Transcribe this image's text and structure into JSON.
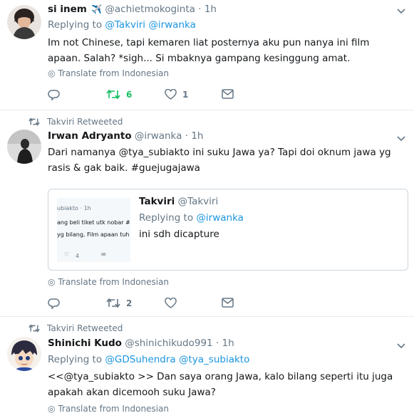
{
  "tweets": [
    {
      "name": "si inem",
      "handle": "@achietmokoginta",
      "time": "1h",
      "replying_label": "Replying to",
      "replying_handles": "@Takviri @irwanka",
      "text": "Im not Chinese, tapi kemaren liat posternya aku pun nanya ini film apaan. Salah? *sigh... Si mbaknya gampang kesinggung amat.",
      "translate": "Translate from Indonesian",
      "retweets": "6",
      "likes": "1"
    },
    {
      "context": "Takviri Retweeted",
      "name": "Irwan Adryanto",
      "handle": "@irwanka",
      "time": "1h",
      "text": "Dari namanya @tya_subiakto ini suku Jawa ya? Tapi doi oknum jawa yg rasis & gak baik. #guejugajawa",
      "quote": {
        "name": "Takviri",
        "handle": "@Takviri",
        "replying_label": "Replying to",
        "replying_handles": "@irwanka",
        "text": "ini sdh dicapture",
        "image_lines": [
          "ubiakto · 1h",
          "ang beli tiket utk nobar #L",
          "yg bilang, Film apaan tuh"
        ],
        "image_like_count": "4"
      },
      "translate": "Translate from Indonesian",
      "retweets": "2"
    },
    {
      "context": "Takviri Retweeted",
      "name": "Shinichi Kudo",
      "handle": "@shinichikudo991",
      "time": "1h",
      "replying_label": "Replying to",
      "replying_handles": "@GDSuhendra @tya_subiakto",
      "text": "<<@tya_subiakto >> Dan saya orang Jawa, kalo bilang seperti itu juga apakah akan dicemooh suku Jawa?",
      "translate": "Translate from Indonesian"
    }
  ],
  "colors": {
    "link": "#1b95e0",
    "muted": "#657786",
    "retweet_green": "#17bf63",
    "border": "#e6ecf0"
  }
}
